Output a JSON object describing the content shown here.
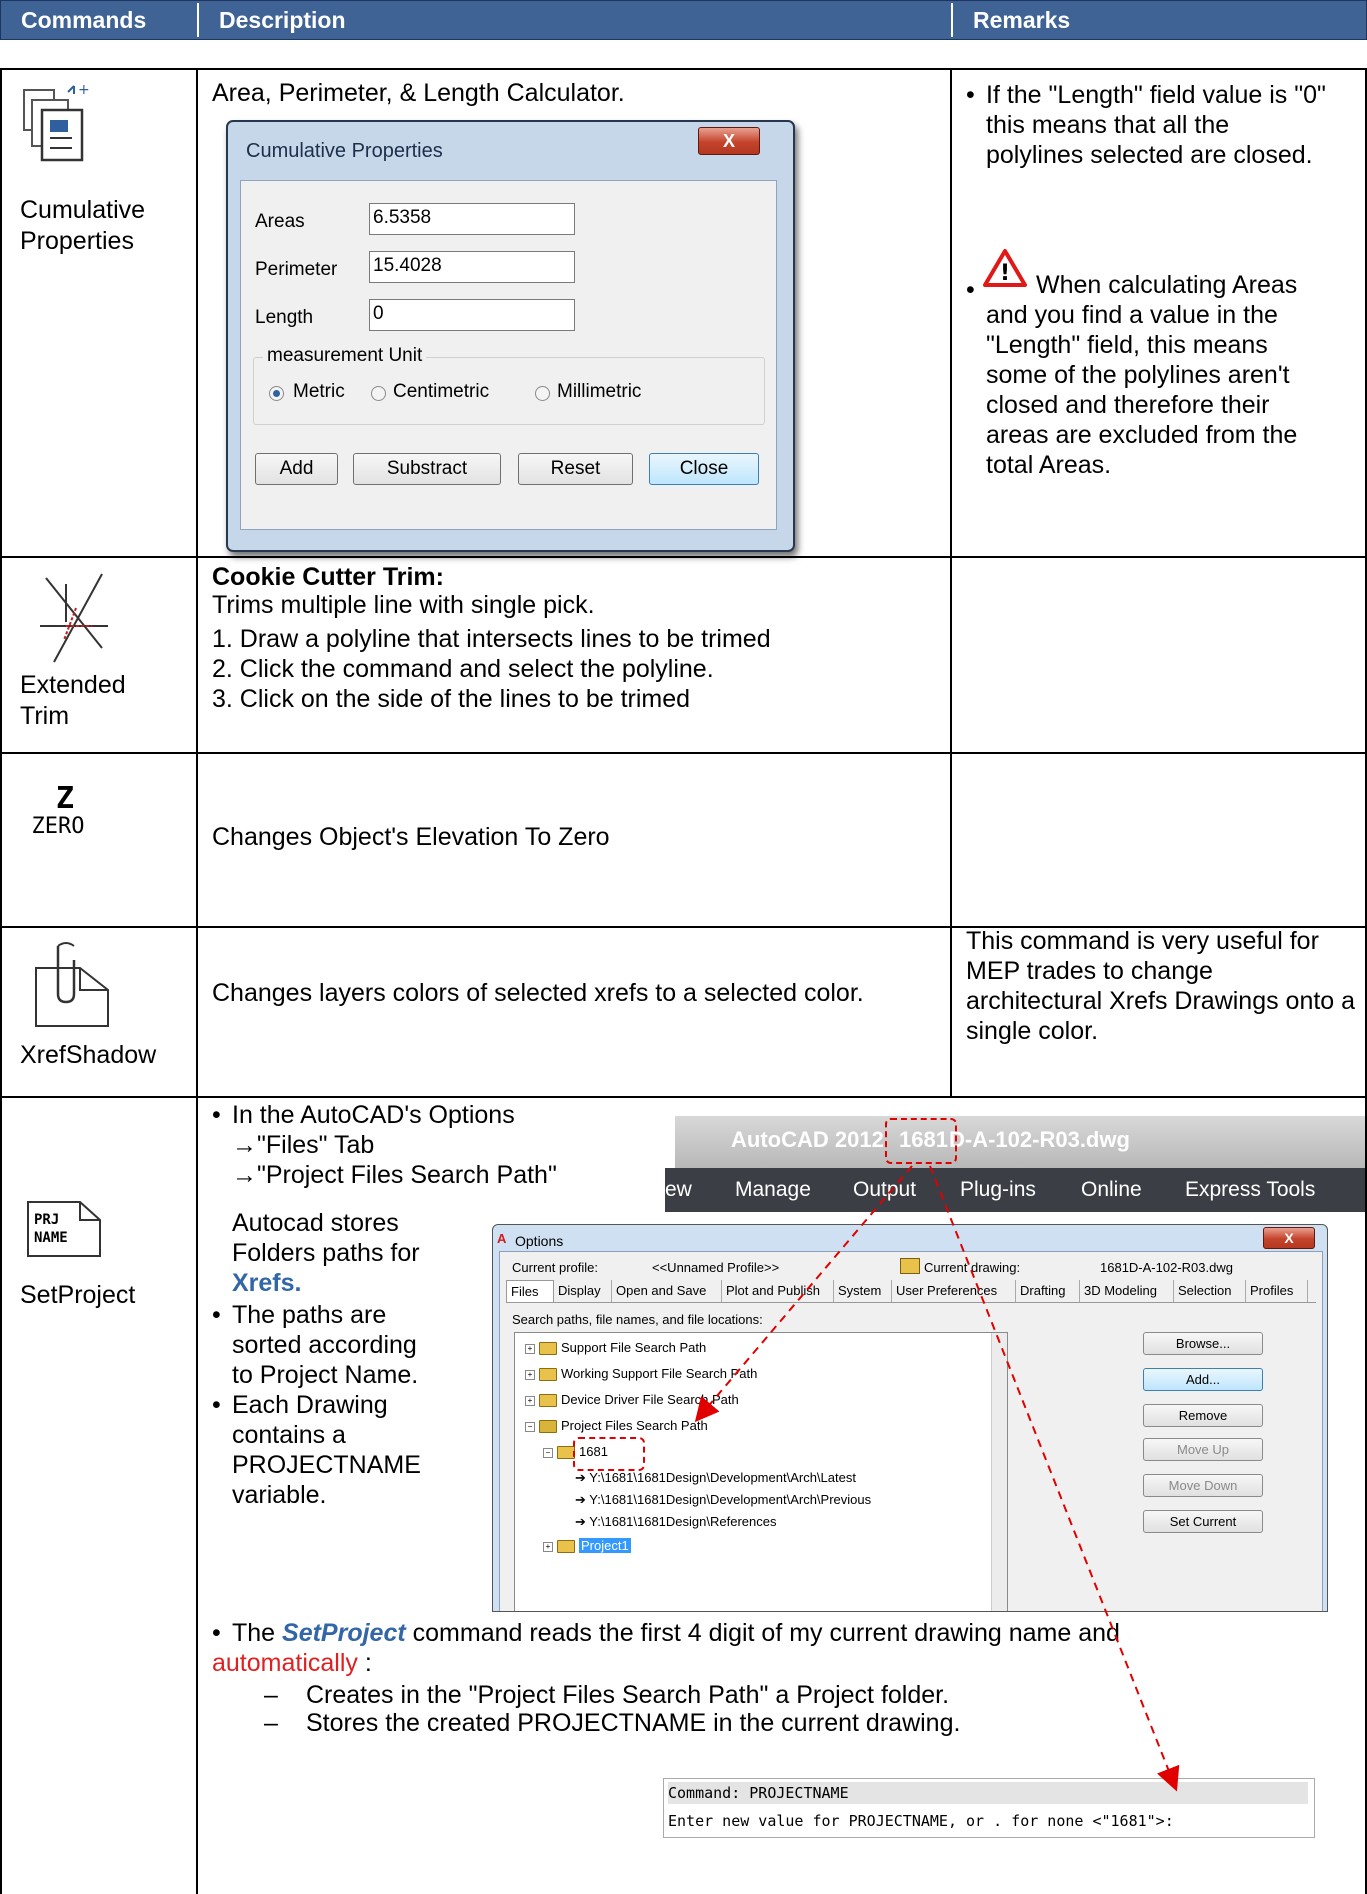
{
  "header": {
    "col1": "Commands",
    "col2": "Description",
    "col3": "Remarks"
  },
  "rows": [
    {
      "name": "Cumulative\nProperties",
      "icon": "cumulative-properties-icon",
      "description": "Area, Perimeter, & Length Calculator.",
      "dialog": {
        "title": "Cumulative Properties",
        "close": "X",
        "fields": [
          {
            "label": "Areas",
            "value": "6.5358"
          },
          {
            "label": "Perimeter",
            "value": "15.4028"
          },
          {
            "label": "Length",
            "value": "0"
          }
        ],
        "group_label": "measurement Unit",
        "units": [
          "Metric",
          "Centimetric",
          "Millimetric"
        ],
        "selected_unit": "Metric",
        "buttons": [
          "Add",
          "Substract",
          "Reset",
          "Close"
        ]
      },
      "remarks": [
        "If the \"Length\" field value is \"0\" this means that all the polylines selected are closed.",
        "When calculating Areas and you find a value in the \"Length\" field, this means some of the polylines aren't closed and therefore their areas are excluded from the total Areas."
      ]
    },
    {
      "name": "Extended\nTrim",
      "icon": "extended-trim-icon",
      "title": "Cookie Cutter Trim:",
      "subtitle": "Trims multiple line with single pick.",
      "steps": [
        "1.  Draw a polyline that intersects lines to be trimed",
        "2.  Click the command and select the polyline.",
        "3.  Click on the side of the lines to be trimed"
      ]
    },
    {
      "icon_text_top": "Z",
      "icon_text_bottom": "ZERO",
      "icon": "zero-elevation-icon",
      "description": "Changes Object's Elevation To Zero"
    },
    {
      "name": "XrefShadow",
      "icon": "xref-shadow-icon",
      "description": "Changes layers colors  of selected xrefs to a selected color.",
      "remarks": "This command is very useful for MEP trades to change architectural Xrefs Drawings onto a single color."
    },
    {
      "name": "SetProject",
      "icon": "project-name-icon",
      "icon_text_top": "PRJ",
      "icon_text_bottom": "NAME",
      "bullet1_lines": [
        "In the AutoCAD's Options",
        "→\"Files\" Tab",
        "→\"Project Files Search Path\""
      ],
      "stores_lines": [
        "Autocad stores",
        "Folders paths for"
      ],
      "stores_highlight": "Xrefs.",
      "bullet2_lines": [
        "The paths are",
        "sorted according",
        "to Project Name."
      ],
      "bullet3_lines": [
        "Each Drawing",
        "contains a",
        "PROJECTNAME",
        "variable."
      ],
      "setproject_intro": "The ",
      "setproject_cmd": "SetProject",
      "setproject_text": " command reads the first 4 digit of my current drawing name and",
      "setproject_auto": "automatically",
      "setproject_colon": " :",
      "dash_items": [
        "Creates in the  \"Project Files Search Path\" a Project folder.",
        "Stores the created PROJECTNAME in the current drawing."
      ],
      "autocad": {
        "title_app": "AutoCAD 2012",
        "title_file_a": "1681",
        "title_file_b": "D-A-102-R03.dwg",
        "menu": [
          "ew",
          "Manage",
          "Output",
          "Plug-ins",
          "Online",
          "Express Tools"
        ]
      },
      "options": {
        "title": "Options",
        "close": "X",
        "profile_label": "Current profile:",
        "profile_value": "<<Unnamed Profile>>",
        "drawing_label": "Current drawing:",
        "drawing_value": "1681D-A-102-R03.dwg",
        "tabs": [
          "Files",
          "Display",
          "Open and Save",
          "Plot and Publish",
          "System",
          "User Preferences",
          "Drafting",
          "3D Modeling",
          "Selection",
          "Profiles"
        ],
        "search_label": "Search paths, file names, and file locations:",
        "tree": [
          "Support File Search Path",
          "Working Support File Search Path",
          "Device Driver File Search Path",
          "Project Files Search Path",
          "1681",
          "Y:\\1681\\1681Design\\Development\\Arch\\Latest",
          "Y:\\1681\\1681Design\\Development\\Arch\\Previous",
          "Y:\\1681\\1681Design\\References",
          "Project1"
        ],
        "buttons": [
          "Browse...",
          "Add...",
          "Remove",
          "Move Up",
          "Move Down",
          "Set Current"
        ]
      },
      "command_line": {
        "line1": "Command:  PROJECTNAME",
        "line2": "Enter new value for PROJECTNAME, or . for none <\"1681\">:"
      }
    }
  ],
  "colors": {
    "header_bg": "#3e6394",
    "highlight_blue": "#3366a6",
    "highlight_red": "#e02020",
    "arrow_red": "#e00000"
  }
}
